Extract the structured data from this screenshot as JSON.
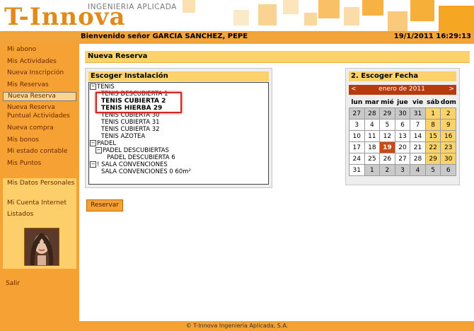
{
  "header": {
    "logo_text": "T-Innova",
    "logo_subtitle": "INGENIERIA APLICADA"
  },
  "welcome": {
    "message": "Bienvenido señor GARCIA SANCHEZ, PEPE",
    "datetime": "19/1/2011 16:29:13"
  },
  "sidebar": {
    "menu": [
      {
        "label": "Mi abono"
      },
      {
        "label": "Mis Actividades"
      },
      {
        "label": "Nueva Inscripción"
      },
      {
        "label": "Mis Reservas"
      },
      {
        "label": "Nueva Reserva"
      },
      {
        "label": "Nueva Reserva Puntual Actividades"
      },
      {
        "label": "Nueva compra"
      },
      {
        "label": "Mis bonos"
      },
      {
        "label": "Mi estado contable"
      },
      {
        "label": "Mis Puntos"
      }
    ],
    "account_menu": [
      {
        "label": "Mis Datos Personales"
      },
      {
        "label": "Mi Cuenta Internet"
      },
      {
        "label": "Listados"
      }
    ],
    "logout": "Salir"
  },
  "main": {
    "page_title": "Nueva Reserva",
    "installations": {
      "title": "Escoger Instalación",
      "tree": [
        {
          "label": "TENIS"
        },
        {
          "label": "TENIS DESCUBIERTA 1"
        },
        {
          "label": "TENIS CUBIERTA 2"
        },
        {
          "label": "TENIS HIERBA 29"
        },
        {
          "label": "TENIS CUBIERTA 30"
        },
        {
          "label": "TENIS CUBIERTA 31"
        },
        {
          "label": "TENIS CUBIERTA 32"
        },
        {
          "label": "TENIS AZOTEA"
        },
        {
          "label": "PADEL"
        },
        {
          "label": "PADEL DESCUBIERTAS"
        },
        {
          "label": "PADEL DESCUBIERTA 6"
        },
        {
          "label": "! SALA CONVENCIONES"
        },
        {
          "label": "SALA CONVENCIONES 0 60m²"
        }
      ],
      "collapse_symbol": "−"
    },
    "calendar": {
      "title": "2. Escoger Fecha",
      "prev": "<",
      "month": "enero de 2011",
      "next": ">",
      "weekdays": [
        "lun",
        "mar",
        "mié",
        "jue",
        "vie",
        "sáb",
        "dom"
      ],
      "weeks": [
        [
          "27",
          "28",
          "29",
          "30",
          "31",
          "1",
          "2"
        ],
        [
          "3",
          "4",
          "5",
          "6",
          "7",
          "8",
          "9"
        ],
        [
          "10",
          "11",
          "12",
          "13",
          "14",
          "15",
          "16"
        ],
        [
          "17",
          "18",
          "19",
          "20",
          "21",
          "22",
          "23"
        ],
        [
          "24",
          "25",
          "26",
          "27",
          "28",
          "29",
          "30"
        ],
        [
          "31",
          "1",
          "2",
          "3",
          "4",
          "5",
          "6"
        ]
      ],
      "selected_day": "19"
    },
    "reserve_button": "Reservar"
  },
  "footer": {
    "copyright": "© T-Innova Ingeniería Aplicada, S.A."
  },
  "colors": {
    "accent": "#f5a133",
    "panel_header": "#fcd36a",
    "today": "#c84a16",
    "highlight": "#d32626"
  }
}
